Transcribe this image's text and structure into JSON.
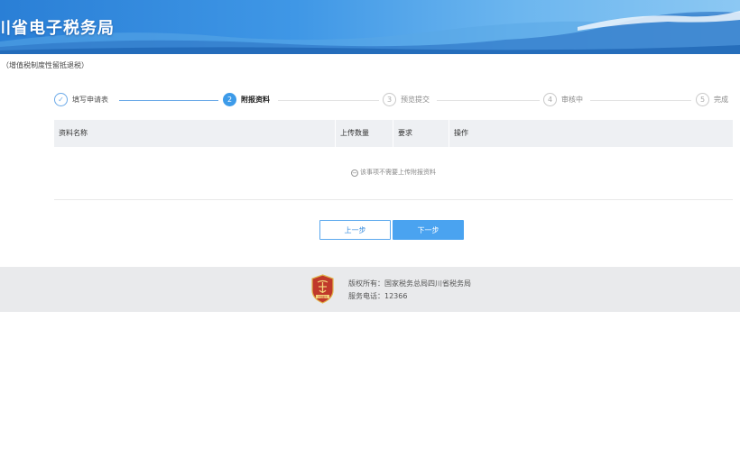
{
  "header": {
    "title": "川省电子税务局"
  },
  "subtitle": "（增值税制度性留抵退税）",
  "stepper": {
    "steps": [
      {
        "num": "✓",
        "label": "填写申请表",
        "state": "done"
      },
      {
        "num": "2",
        "label": "附报资料",
        "state": "active"
      },
      {
        "num": "3",
        "label": "预览提交",
        "state": "pending"
      },
      {
        "num": "4",
        "label": "审核中",
        "state": "pending"
      },
      {
        "num": "5",
        "label": "完成",
        "state": "pending"
      }
    ]
  },
  "table": {
    "columns": [
      "资料名称",
      "上传数量",
      "要求",
      "操作"
    ],
    "empty_icon": "−",
    "empty_message": "该事项不需要上传附报资料"
  },
  "buttons": {
    "prev": "上一步",
    "next": "下一步"
  },
  "footer": {
    "logo_text": "中国税务",
    "copyright": "版权所有：国家税务总局四川省税务局",
    "phone": "服务电话：12366"
  },
  "colors": {
    "accent": "#3d9be9",
    "banner": "#2a7fd6",
    "footer_bg": "#e9eaec",
    "logo_red": "#c0392b"
  }
}
